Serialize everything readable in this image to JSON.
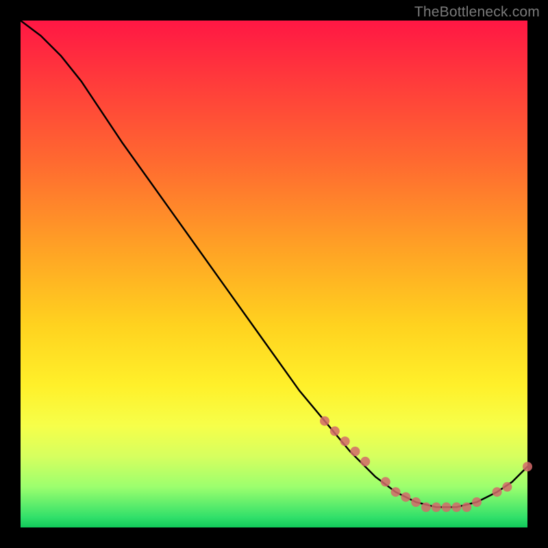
{
  "watermark": "TheBottleneck.com",
  "chart_data": {
    "type": "line",
    "title": "",
    "xlabel": "",
    "ylabel": "",
    "xlim": [
      0,
      100
    ],
    "ylim": [
      0,
      100
    ],
    "series": [
      {
        "name": "bottleneck-curve",
        "x": [
          0,
          4,
          8,
          12,
          16,
          20,
          25,
          30,
          35,
          40,
          45,
          50,
          55,
          60,
          65,
          70,
          74,
          78,
          82,
          86,
          90,
          94,
          97,
          100
        ],
        "y": [
          100,
          97,
          93,
          88,
          82,
          76,
          69,
          62,
          55,
          48,
          41,
          34,
          27,
          21,
          15,
          10,
          7,
          5,
          4,
          4,
          5,
          7,
          9,
          12
        ]
      }
    ],
    "markers": {
      "name": "highlight-points",
      "color": "#d46a6a",
      "x": [
        60,
        62,
        64,
        66,
        68,
        72,
        74,
        76,
        78,
        80,
        82,
        84,
        86,
        88,
        90,
        94,
        96,
        100
      ],
      "y": [
        21,
        19,
        17,
        15,
        13,
        9,
        7,
        6,
        5,
        4,
        4,
        4,
        4,
        4,
        5,
        7,
        8,
        12
      ]
    }
  }
}
